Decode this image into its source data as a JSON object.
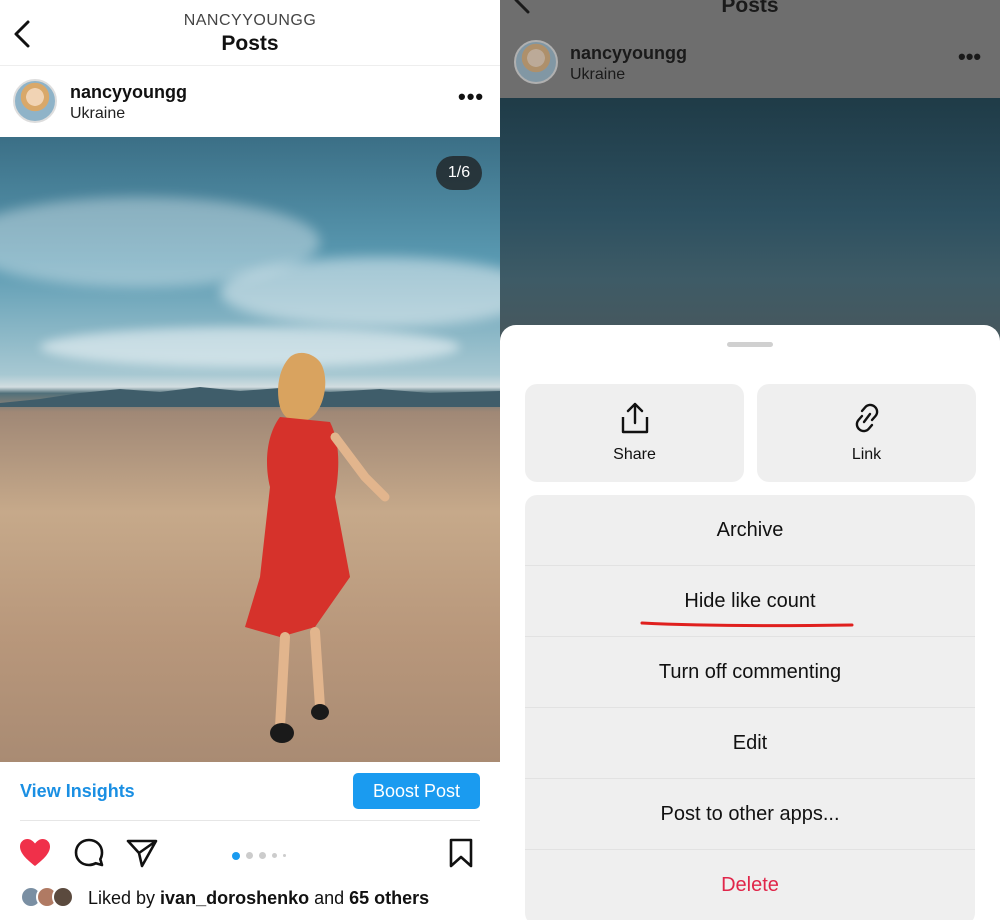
{
  "left": {
    "nav": {
      "username_caps": "NANCYYOUNGG",
      "title": "Posts"
    },
    "post": {
      "username": "nancyyoungg",
      "location": "Ukraine",
      "image_counter": "1/6"
    },
    "view_insights": "View Insights",
    "boost_post": "Boost Post",
    "carousel": {
      "current": 1,
      "dots": 6
    },
    "likes": {
      "prefix": "Liked by ",
      "user": "ivan_doroshenko",
      "middle": " and ",
      "others": "65 others"
    },
    "colors": {
      "accent": "#1a9bf0",
      "link": "#1a8fe3",
      "heart": "#f0304a"
    }
  },
  "right": {
    "nav_title": "Posts",
    "post": {
      "username": "nancyyoungg",
      "location": "Ukraine"
    },
    "sheet": {
      "tiles": [
        {
          "label": "Share",
          "icon": "share-icon"
        },
        {
          "label": "Link",
          "icon": "link-icon"
        }
      ],
      "menu": [
        {
          "label": "Archive"
        },
        {
          "label": "Hide like count"
        },
        {
          "label": "Turn off commenting"
        },
        {
          "label": "Edit"
        },
        {
          "label": "Post to other apps..."
        },
        {
          "label": "Delete"
        }
      ],
      "colors": {
        "danger": "#e0264a",
        "annotation": "#e0201e"
      }
    }
  }
}
